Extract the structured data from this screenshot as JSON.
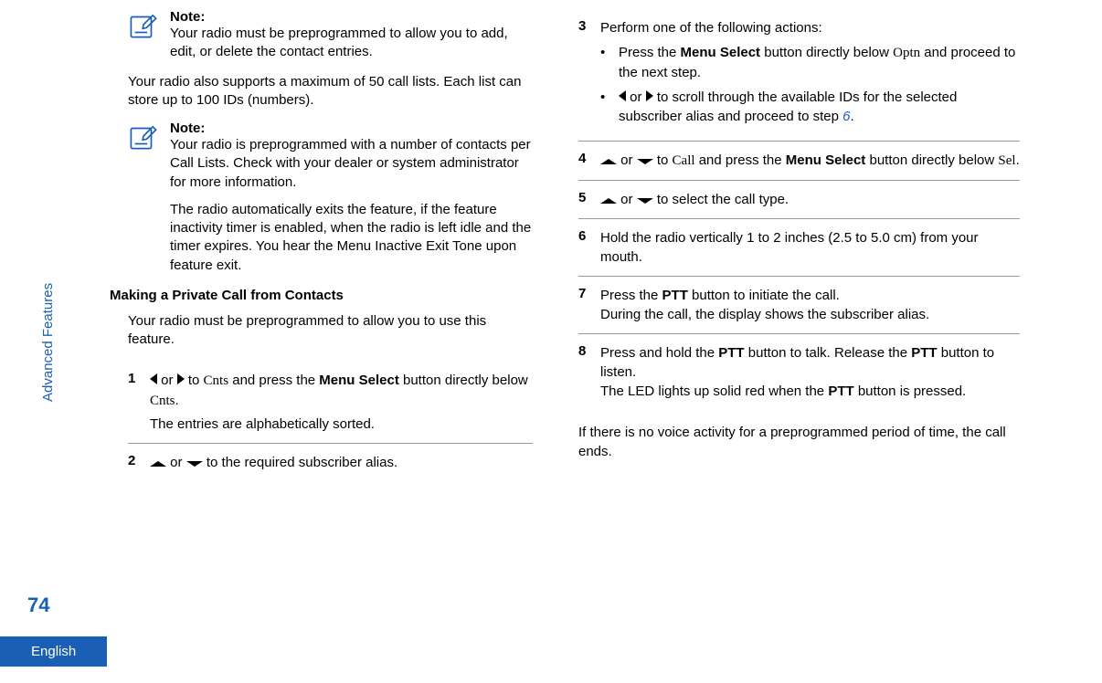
{
  "sidebar": {
    "section": "Advanced Features",
    "page_number": "74",
    "language": "English"
  },
  "col1": {
    "note1": {
      "label": "Note:",
      "text": "Your radio must be preprogrammed to allow you to add, edit, or delete the contact entries."
    },
    "para1": "Your radio also supports a maximum of 50 call lists. Each list can store up to 100 IDs (numbers).",
    "note2": {
      "label": "Note:",
      "text1": "Your radio is preprogrammed with a number of contacts per Call Lists. Check with your dealer or system administrator for more information.",
      "text2": "The radio automatically exits the feature, if the feature inactivity timer is enabled, when the radio is left idle and the timer expires. You hear the Menu Inactive Exit Tone upon feature exit."
    },
    "heading": "Making a Private Call from Contacts",
    "intro": "Your radio must be preprogrammed to allow you to use this feature.",
    "step1": {
      "num": "1",
      "pre": " or ",
      "mid": " to ",
      "cnts": "Cnts",
      "text2": " and press the ",
      "bold1": "Menu Select",
      "text3": " button directly below ",
      "cnts2": "Cnts",
      "period": ".",
      "sub": "The entries are alphabetically sorted."
    },
    "step2": {
      "num": "2",
      "or": " or ",
      "text": " to the required subscriber alias."
    }
  },
  "col2": {
    "step3": {
      "num": "3",
      "text": "Perform one of the following actions:",
      "b1_pre": "Press the ",
      "b1_bold": "Menu Select",
      "b1_mid": " button directly below ",
      "b1_optn": "Optn",
      "b1_end": " and proceed to the next step.",
      "b2_or": " or ",
      "b2_mid": " to scroll through the available IDs for the selected subscriber alias and proceed to step ",
      "b2_link": "6",
      "b2_period": "."
    },
    "step4": {
      "num": "4",
      "or": " or ",
      "to": " to ",
      "call": "Call",
      "mid": " and press the ",
      "bold": "Menu Select",
      "mid2": " button directly below ",
      "sel": "Sel",
      "period": "."
    },
    "step5": {
      "num": "5",
      "or": " or ",
      "text": " to select the call type."
    },
    "step6": {
      "num": "6",
      "text": "Hold the radio vertically 1 to 2 inches (2.5 to 5.0 cm) from your mouth."
    },
    "step7": {
      "num": "7",
      "pre": "Press the ",
      "bold": "PTT",
      "mid": " button to initiate the call.",
      "sub": "During the call, the display shows the subscriber alias."
    },
    "step8": {
      "num": "8",
      "pre": "Press and hold the ",
      "bold1": "PTT",
      "mid1": " button to talk. Release the ",
      "bold2": "PTT",
      "mid2": " button to listen.",
      "sub_pre": "The LED lights up solid red when the ",
      "sub_bold": "PTT",
      "sub_end": " button is pressed."
    },
    "after": "If there is no voice activity for a preprogrammed period of time, the call ends."
  }
}
